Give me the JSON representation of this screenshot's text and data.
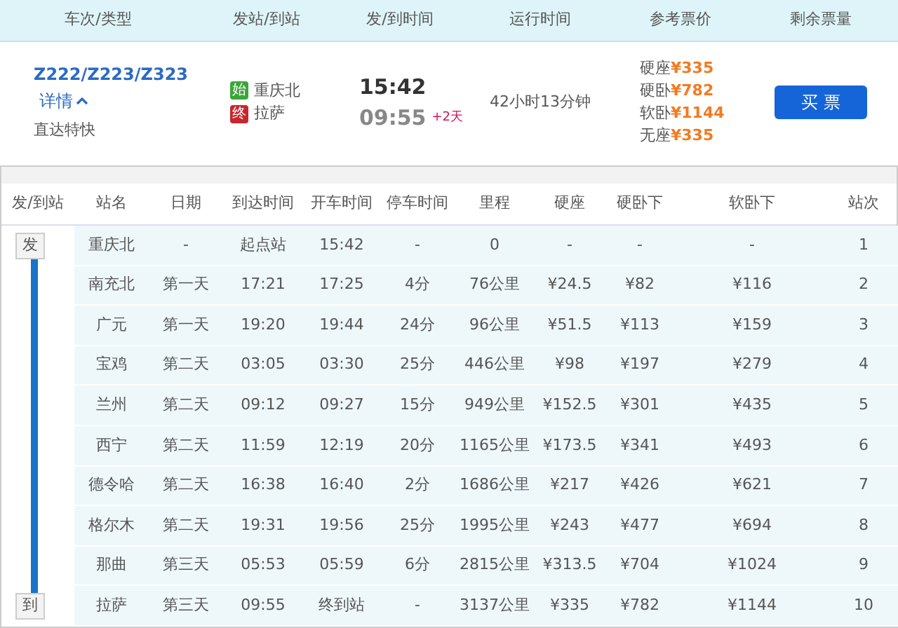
{
  "header": [
    "车次/类型",
    "发站/到站",
    "发/到时间",
    "运行时间",
    "参考票价",
    "剩余票量"
  ],
  "train": {
    "number": "Z222/Z223/Z323",
    "details_link": "详情",
    "expanded": true,
    "type": "直达特快",
    "stations": [
      {
        "kind": "origin",
        "tag": "始",
        "name": "重庆北"
      },
      {
        "kind": "destination",
        "tag": "终",
        "name": "拉萨"
      }
    ],
    "depart_time": "15:42",
    "arrive_time": "09:55",
    "day_offset": "+2天",
    "duration": "42小时13分钟",
    "prices": [
      {
        "seat": "硬座",
        "price": "¥335"
      },
      {
        "seat": "硬卧",
        "price": "¥782"
      },
      {
        "seat": "软卧",
        "price": "¥1144"
      },
      {
        "seat": "无座",
        "price": "¥335"
      }
    ],
    "buy_button": "买 票"
  },
  "stops": {
    "columns": [
      "发/到站",
      "站名",
      "日期",
      "到达时间",
      "开车时间",
      "停车时间",
      "里程",
      "硬座",
      "硬卧下",
      "软卧下",
      "站次"
    ],
    "rows": [
      [
        "发",
        "重庆北",
        "-",
        "起点站",
        "15:42",
        "-",
        "0",
        "-",
        "-",
        "-",
        "1"
      ],
      [
        "",
        "南充北",
        "第一天",
        "17:21",
        "17:25",
        "4分",
        "76公里",
        "¥24.5",
        "¥82",
        "¥116",
        "2"
      ],
      [
        "",
        "广元",
        "第一天",
        "19:20",
        "19:44",
        "24分",
        "96公里",
        "¥51.5",
        "¥113",
        "¥159",
        "3"
      ],
      [
        "",
        "宝鸡",
        "第二天",
        "03:05",
        "03:30",
        "25分",
        "446公里",
        "¥98",
        "¥197",
        "¥279",
        "4"
      ],
      [
        "",
        "兰州",
        "第二天",
        "09:12",
        "09:27",
        "15分",
        "949公里",
        "¥152.5",
        "¥301",
        "¥435",
        "5"
      ],
      [
        "",
        "西宁",
        "第二天",
        "11:59",
        "12:19",
        "20分",
        "1165公里",
        "¥173.5",
        "¥341",
        "¥493",
        "6"
      ],
      [
        "",
        "德令哈",
        "第二天",
        "16:38",
        "16:40",
        "2分",
        "1686公里",
        "¥217",
        "¥426",
        "¥621",
        "7"
      ],
      [
        "",
        "格尔木",
        "第二天",
        "19:31",
        "19:56",
        "25分",
        "1995公里",
        "¥243",
        "¥477",
        "¥694",
        "8"
      ],
      [
        "",
        "那曲",
        "第三天",
        "05:53",
        "05:59",
        "6分",
        "2815公里",
        "¥313.5",
        "¥704",
        "¥1024",
        "9"
      ],
      [
        "到",
        "拉萨",
        "第三天",
        "09:55",
        "终到站",
        "-",
        "3137公里",
        "¥335",
        "¥782",
        "¥1144",
        "10"
      ]
    ]
  }
}
